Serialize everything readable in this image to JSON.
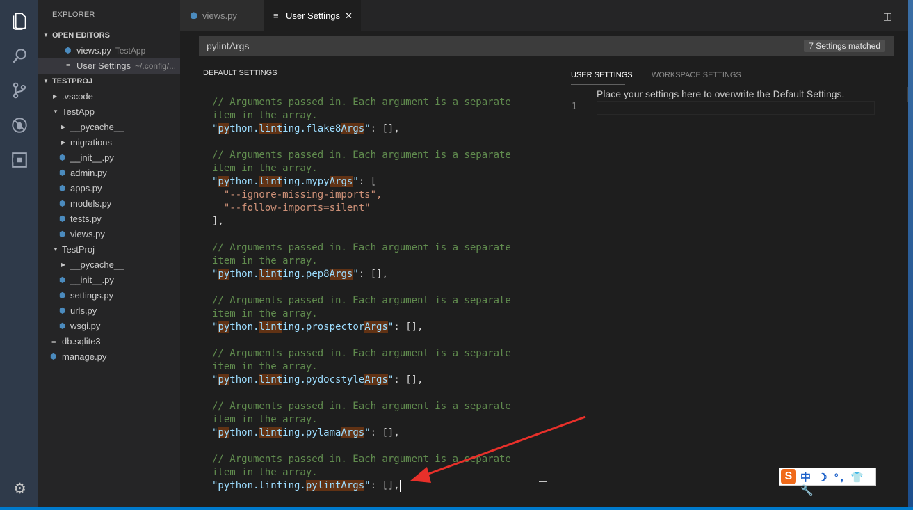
{
  "sidebar": {
    "title": "EXPLORER",
    "open_editors_label": "OPEN EDITORS",
    "open_editors": [
      {
        "name": "views.py",
        "desc": "TestApp"
      },
      {
        "name": "User Settings",
        "desc": "~/.config/..."
      }
    ],
    "project_label": "TESTPROJ",
    "tree": [
      {
        "name": ".vscode",
        "type": "folder",
        "open": false
      },
      {
        "name": "TestApp",
        "type": "folder",
        "open": true
      },
      {
        "name": "__pycache__",
        "type": "folder",
        "open": false
      },
      {
        "name": "migrations",
        "type": "folder",
        "open": false
      },
      {
        "name": "__init__.py",
        "type": "py"
      },
      {
        "name": "admin.py",
        "type": "py"
      },
      {
        "name": "apps.py",
        "type": "py"
      },
      {
        "name": "models.py",
        "type": "py"
      },
      {
        "name": "tests.py",
        "type": "py"
      },
      {
        "name": "views.py",
        "type": "py"
      },
      {
        "name": "TestProj",
        "type": "folder",
        "open": true
      },
      {
        "name": "__pycache__",
        "type": "folder",
        "open": false
      },
      {
        "name": "__init__.py",
        "type": "py"
      },
      {
        "name": "settings.py",
        "type": "py"
      },
      {
        "name": "urls.py",
        "type": "py"
      },
      {
        "name": "wsgi.py",
        "type": "py"
      },
      {
        "name": "db.sqlite3",
        "type": "file"
      },
      {
        "name": "manage.py",
        "type": "py"
      }
    ]
  },
  "tabs": [
    {
      "label": "views.py",
      "active": false
    },
    {
      "label": "User Settings",
      "active": true
    }
  ],
  "search": {
    "value": "pylintArgs",
    "matched": "7 Settings matched"
  },
  "default_settings": {
    "header": "DEFAULT SETTINGS",
    "comment_a": "// Arguments passed in. Each argument is a separate",
    "comment_b": "item in the array.",
    "mypy_args": [
      "\"--ignore-missing-imports\",",
      "\"--follow-imports=silent\""
    ]
  },
  "user_settings": {
    "tab_user": "USER SETTINGS",
    "tab_workspace": "WORKSPACE SETTINGS",
    "placeholder": "Place your settings here to overwrite the Default Settings.",
    "line_number": "1"
  },
  "ime": {
    "logo": "S",
    "text": "中 ☽ °, 👕 🔧"
  },
  "colors": {
    "accent": "#007acc",
    "match_highlight": "#613214",
    "comment": "#608b4e",
    "key": "#9cdcfe"
  }
}
